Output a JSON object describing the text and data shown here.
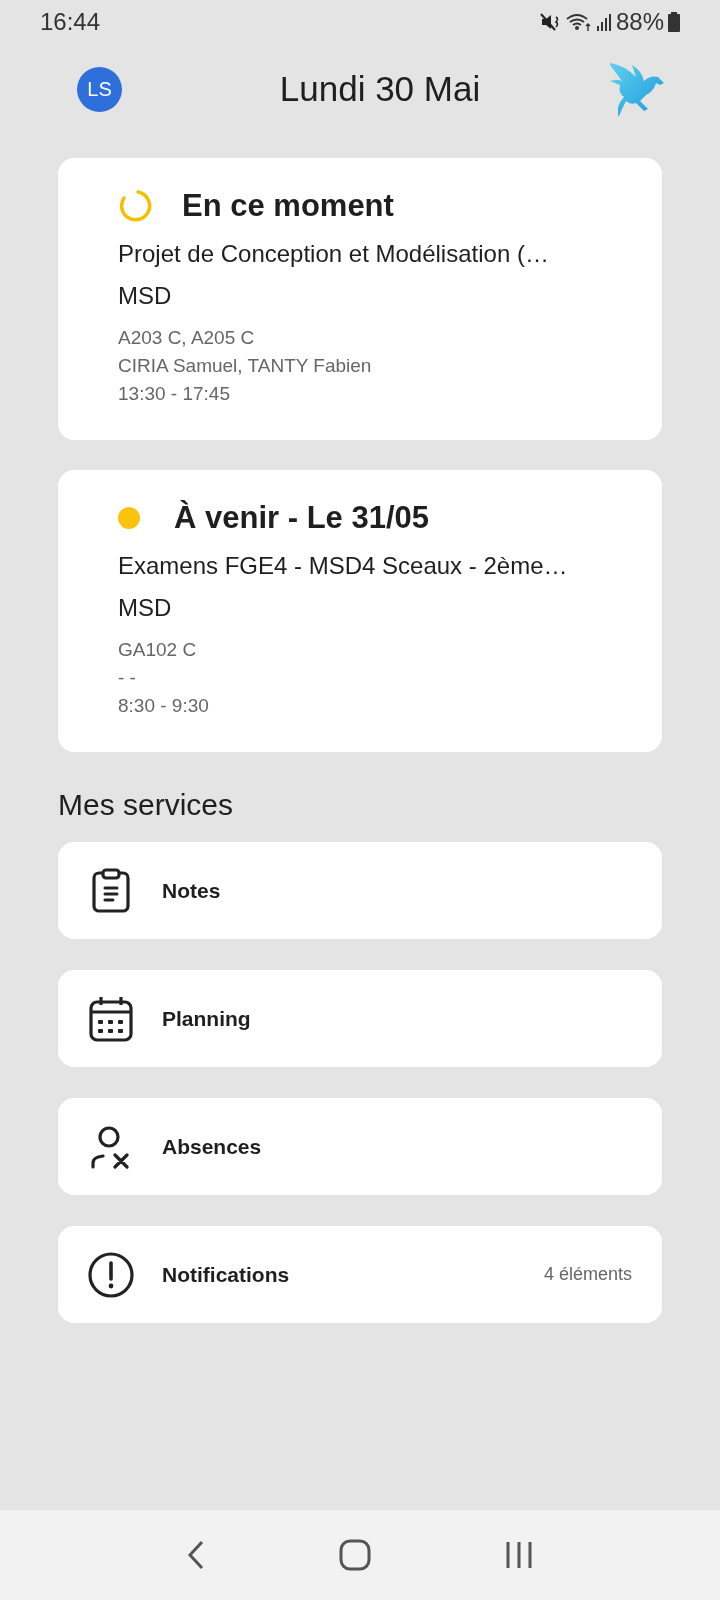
{
  "status_bar": {
    "time": "16:44",
    "battery": "88%"
  },
  "header": {
    "avatar": "LS",
    "title": "Lundi 30 Mai"
  },
  "events": [
    {
      "kind": "current",
      "heading": "En ce moment",
      "course": "Projet de Conception et Modélisation (…",
      "group": "MSD",
      "rooms": "A203 C, A205 C",
      "teachers": "CIRIA Samuel, TANTY Fabien",
      "time": "13:30 - 17:45"
    },
    {
      "kind": "upcoming",
      "heading": "À venir - Le 31/05",
      "course": "Examens FGE4 - MSD4 Sceaux - 2ème…",
      "group": "MSD",
      "rooms": "GA102 C",
      "teachers": "- -",
      "time": "8:30 - 9:30"
    }
  ],
  "services": {
    "title": "Mes services",
    "items": [
      {
        "kind": "notes",
        "label": "Notes"
      },
      {
        "kind": "planning",
        "label": "Planning"
      },
      {
        "kind": "absences",
        "label": "Absences"
      },
      {
        "kind": "notifications",
        "label": "Notifications",
        "count": "4 éléments"
      }
    ]
  }
}
